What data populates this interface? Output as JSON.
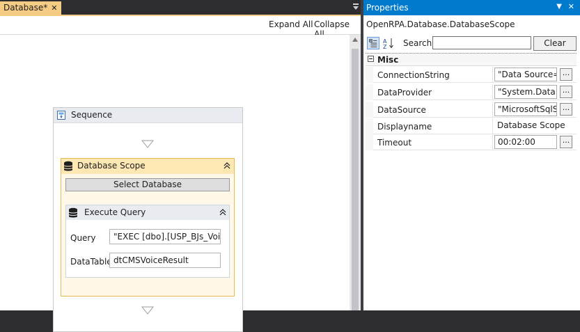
{
  "designer": {
    "tab_label": "Database*",
    "tab_close": "✕",
    "toolbar": {
      "expand_all": "Expand All",
      "collapse_all": "Collapse All"
    },
    "sequence": {
      "title": "Sequence",
      "database_scope": {
        "title": "Database Scope",
        "select_button": "Select Database",
        "execute_query": {
          "title": "Execute Query",
          "query_label": "Query",
          "query_value": "\"EXEC [dbo].[USP_BJs_Voice_Ho",
          "datatable_label": "DataTable",
          "datatable_value": "dtCMSVoiceResult"
        }
      }
    }
  },
  "properties": {
    "title": "Properties",
    "pin": "▼",
    "close": "✕",
    "object_name": "OpenRPA.Database.DatabaseScope",
    "search_label": "Search:",
    "search_value": "",
    "clear_button": "Clear",
    "category": "Misc",
    "rows": [
      {
        "name": "ConnectionString",
        "value": "\"Data Source=c",
        "has_button": true
      },
      {
        "name": "DataProvider",
        "value": "\"System.Data.Sq",
        "has_button": true
      },
      {
        "name": "DataSource",
        "value": "\"MicrosoftSqlSe",
        "has_button": true
      },
      {
        "name": "Displayname",
        "value": "Database Scope",
        "has_button": false
      },
      {
        "name": "Timeout",
        "value": "00:02:00",
        "has_button": true
      }
    ],
    "ellipsis": "..."
  },
  "colors": {
    "tab_active": "#f5cc84",
    "titlebar_blue": "#007acc",
    "scope_border": "#e7b94f",
    "scope_header": "#fde8b4",
    "dark_chrome": "#2d2d30"
  },
  "icons": {
    "sequence": "sequence-icon",
    "database": "database-icon",
    "collapse": "double-chevron-up-icon",
    "categorized": "categorized-icon",
    "alphabetical": "sort-alpha-icon"
  }
}
